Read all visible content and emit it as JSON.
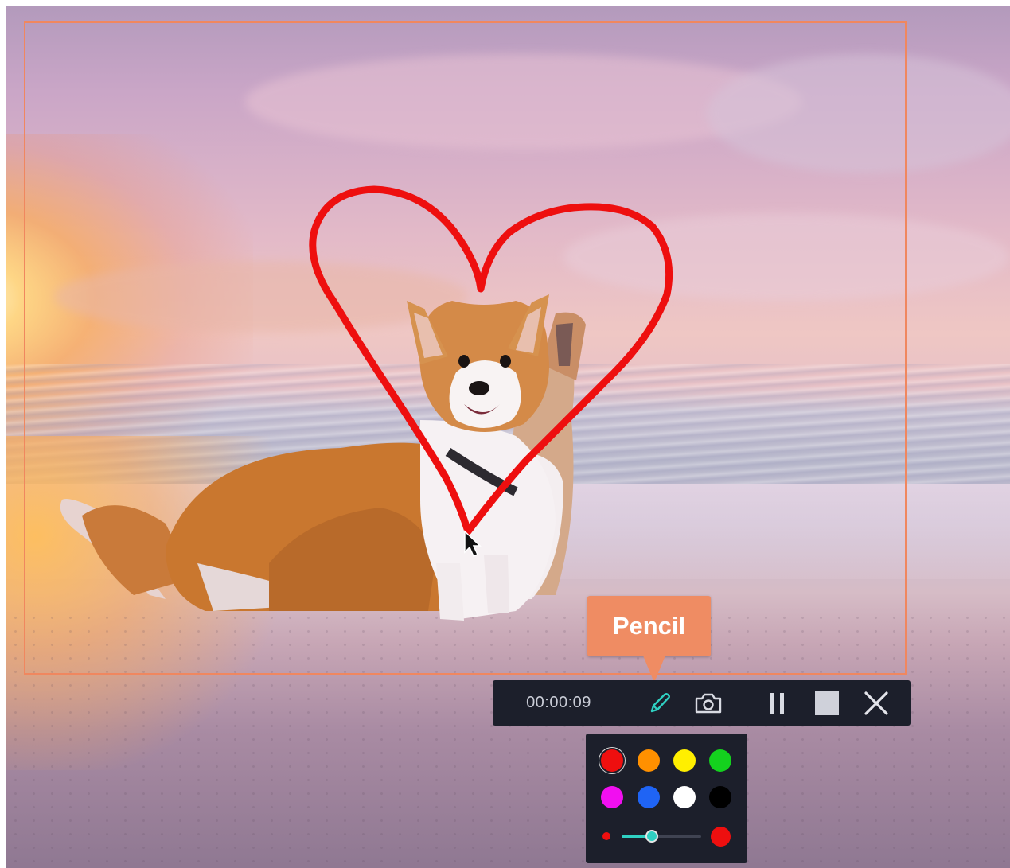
{
  "recorder": {
    "timer": "00:00:09",
    "tooltip": "Pencil",
    "buttons": [
      "pencil-icon",
      "camera-icon",
      "pause-icon",
      "stop-icon",
      "close-icon"
    ],
    "accent_color": "#2fd0c2",
    "frame_color": "#f0875f",
    "tooltip_color": "#ef8c63"
  },
  "palette": {
    "colors": [
      "#ee0f0f",
      "#ff9000",
      "#ffef00",
      "#14d11e",
      "#f10ff0",
      "#1f64f5",
      "#ffffff",
      "#000000"
    ],
    "selected_color": "#ee0f0f",
    "brush_size": 0.38
  },
  "drawing": {
    "shape": "heart",
    "stroke_color": "#ee0f0f"
  }
}
